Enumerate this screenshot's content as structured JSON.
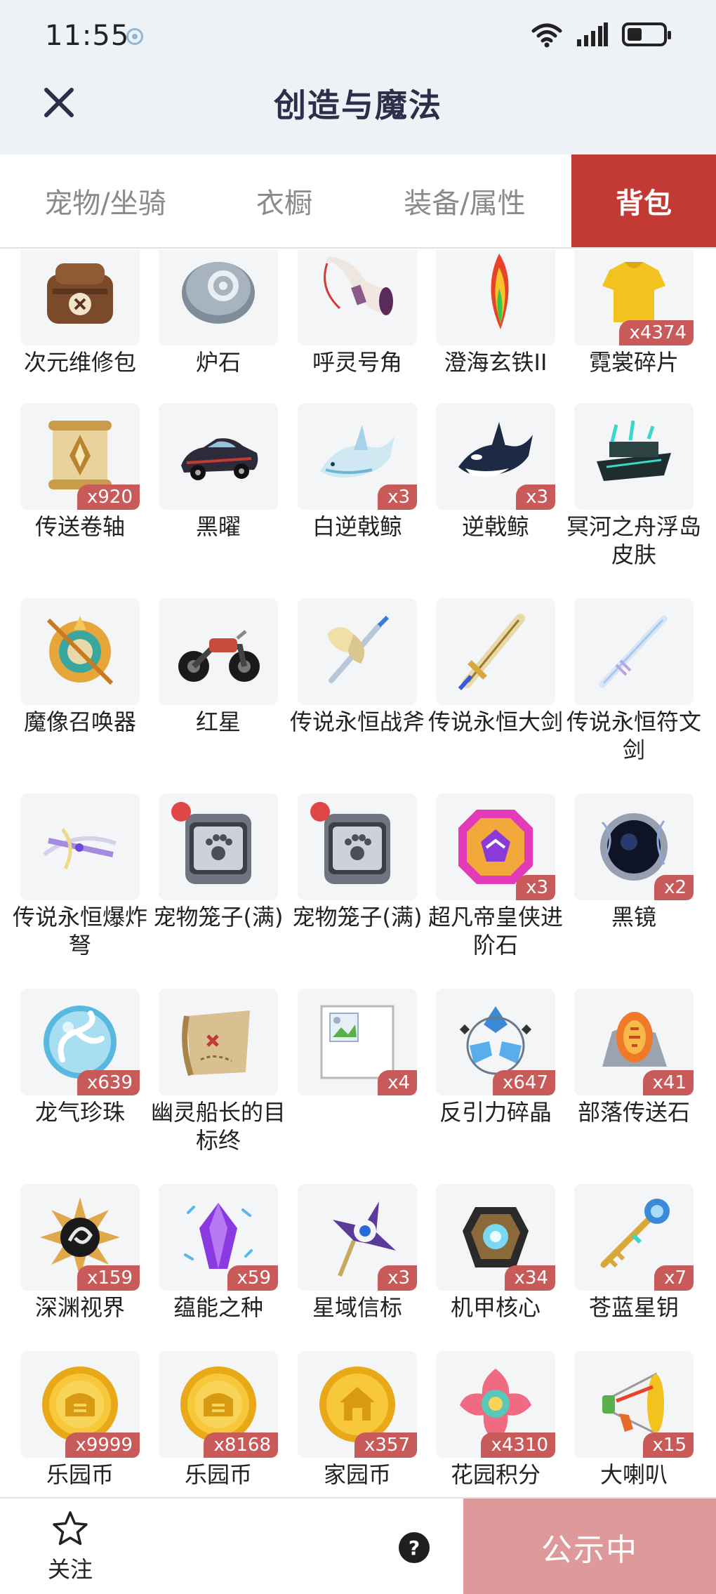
{
  "status_bar": {
    "time": "11:55"
  },
  "header": {
    "title": "创造与魔法"
  },
  "tabs": [
    {
      "label": "宠物/坐骑"
    },
    {
      "label": "衣橱"
    },
    {
      "label": "装备/属性"
    },
    {
      "label": "背包"
    }
  ],
  "items": [
    {
      "name": "次元维修包",
      "count": "",
      "icon": "repair-bag-icon"
    },
    {
      "name": "炉石",
      "count": "",
      "icon": "hearthstone-icon"
    },
    {
      "name": "呼灵号角",
      "count": "",
      "icon": "horn-icon"
    },
    {
      "name": "澄海玄铁II",
      "count": "",
      "icon": "feather-crystal-icon"
    },
    {
      "name": "霓裳碎片",
      "count": "x4374",
      "icon": "shirt-fragment-icon"
    },
    {
      "name": "传送卷轴",
      "count": "x920",
      "icon": "teleport-scroll-icon"
    },
    {
      "name": "黑曜",
      "count": "",
      "icon": "car-icon"
    },
    {
      "name": "白逆戟鲸",
      "count": "x3",
      "icon": "white-orca-icon"
    },
    {
      "name": "逆戟鲸",
      "count": "x3",
      "icon": "orca-icon"
    },
    {
      "name": "冥河之舟浮岛皮肤",
      "count": "",
      "icon": "ghost-ship-icon"
    },
    {
      "name": "魔像召唤器",
      "count": "",
      "icon": "golem-summoner-icon"
    },
    {
      "name": "红星",
      "count": "",
      "icon": "motorcycle-icon"
    },
    {
      "name": "传说永恒战斧",
      "count": "",
      "icon": "axe-icon"
    },
    {
      "name": "传说永恒大剑",
      "count": "",
      "icon": "greatsword-icon"
    },
    {
      "name": "传说永恒符文剑",
      "count": "",
      "icon": "rune-sword-icon"
    },
    {
      "name": "传说永恒爆炸弩",
      "count": "",
      "icon": "crossbow-icon"
    },
    {
      "name": "宠物笼子(满)",
      "count": "",
      "icon": "pet-cage-icon"
    },
    {
      "name": "宠物笼子(满)",
      "count": "",
      "icon": "pet-cage-icon"
    },
    {
      "name": "超凡帝皇侠进阶石",
      "count": "x3",
      "icon": "gem-icon"
    },
    {
      "name": "黑镜",
      "count": "x2",
      "icon": "black-mirror-icon"
    },
    {
      "name": "龙气珍珠",
      "count": "x639",
      "icon": "dragon-pearl-icon"
    },
    {
      "name": "幽灵船长的目标终",
      "count": "",
      "icon": "treasure-map-icon"
    },
    {
      "name": "",
      "count": "x4",
      "icon": "broken-image-icon"
    },
    {
      "name": "反引力碎晶",
      "count": "x647",
      "icon": "antigravity-crystal-icon"
    },
    {
      "name": "部落传送石",
      "count": "x41",
      "icon": "tribe-stone-icon"
    },
    {
      "name": "深渊视界",
      "count": "x159",
      "icon": "abyss-eye-icon"
    },
    {
      "name": "蕴能之种",
      "count": "x59",
      "icon": "energy-seed-icon"
    },
    {
      "name": "星域信标",
      "count": "x3",
      "icon": "star-beacon-icon"
    },
    {
      "name": "机甲核心",
      "count": "x34",
      "icon": "mech-core-icon"
    },
    {
      "name": "苍蓝星钥",
      "count": "x7",
      "icon": "star-key-icon"
    },
    {
      "name": "乐园币",
      "count": "x9999",
      "icon": "paradise-coin-icon"
    },
    {
      "name": "乐园币",
      "count": "x8168",
      "icon": "paradise-coin-icon"
    },
    {
      "name": "家园币",
      "count": "x357",
      "icon": "home-coin-icon"
    },
    {
      "name": "花园积分",
      "count": "x4310",
      "icon": "garden-points-icon"
    },
    {
      "name": "大喇叭",
      "count": "x15",
      "icon": "megaphone-icon"
    }
  ],
  "bottom_bar": {
    "follow_label": "关注",
    "help_label": "?",
    "publish_label": "公示中"
  }
}
